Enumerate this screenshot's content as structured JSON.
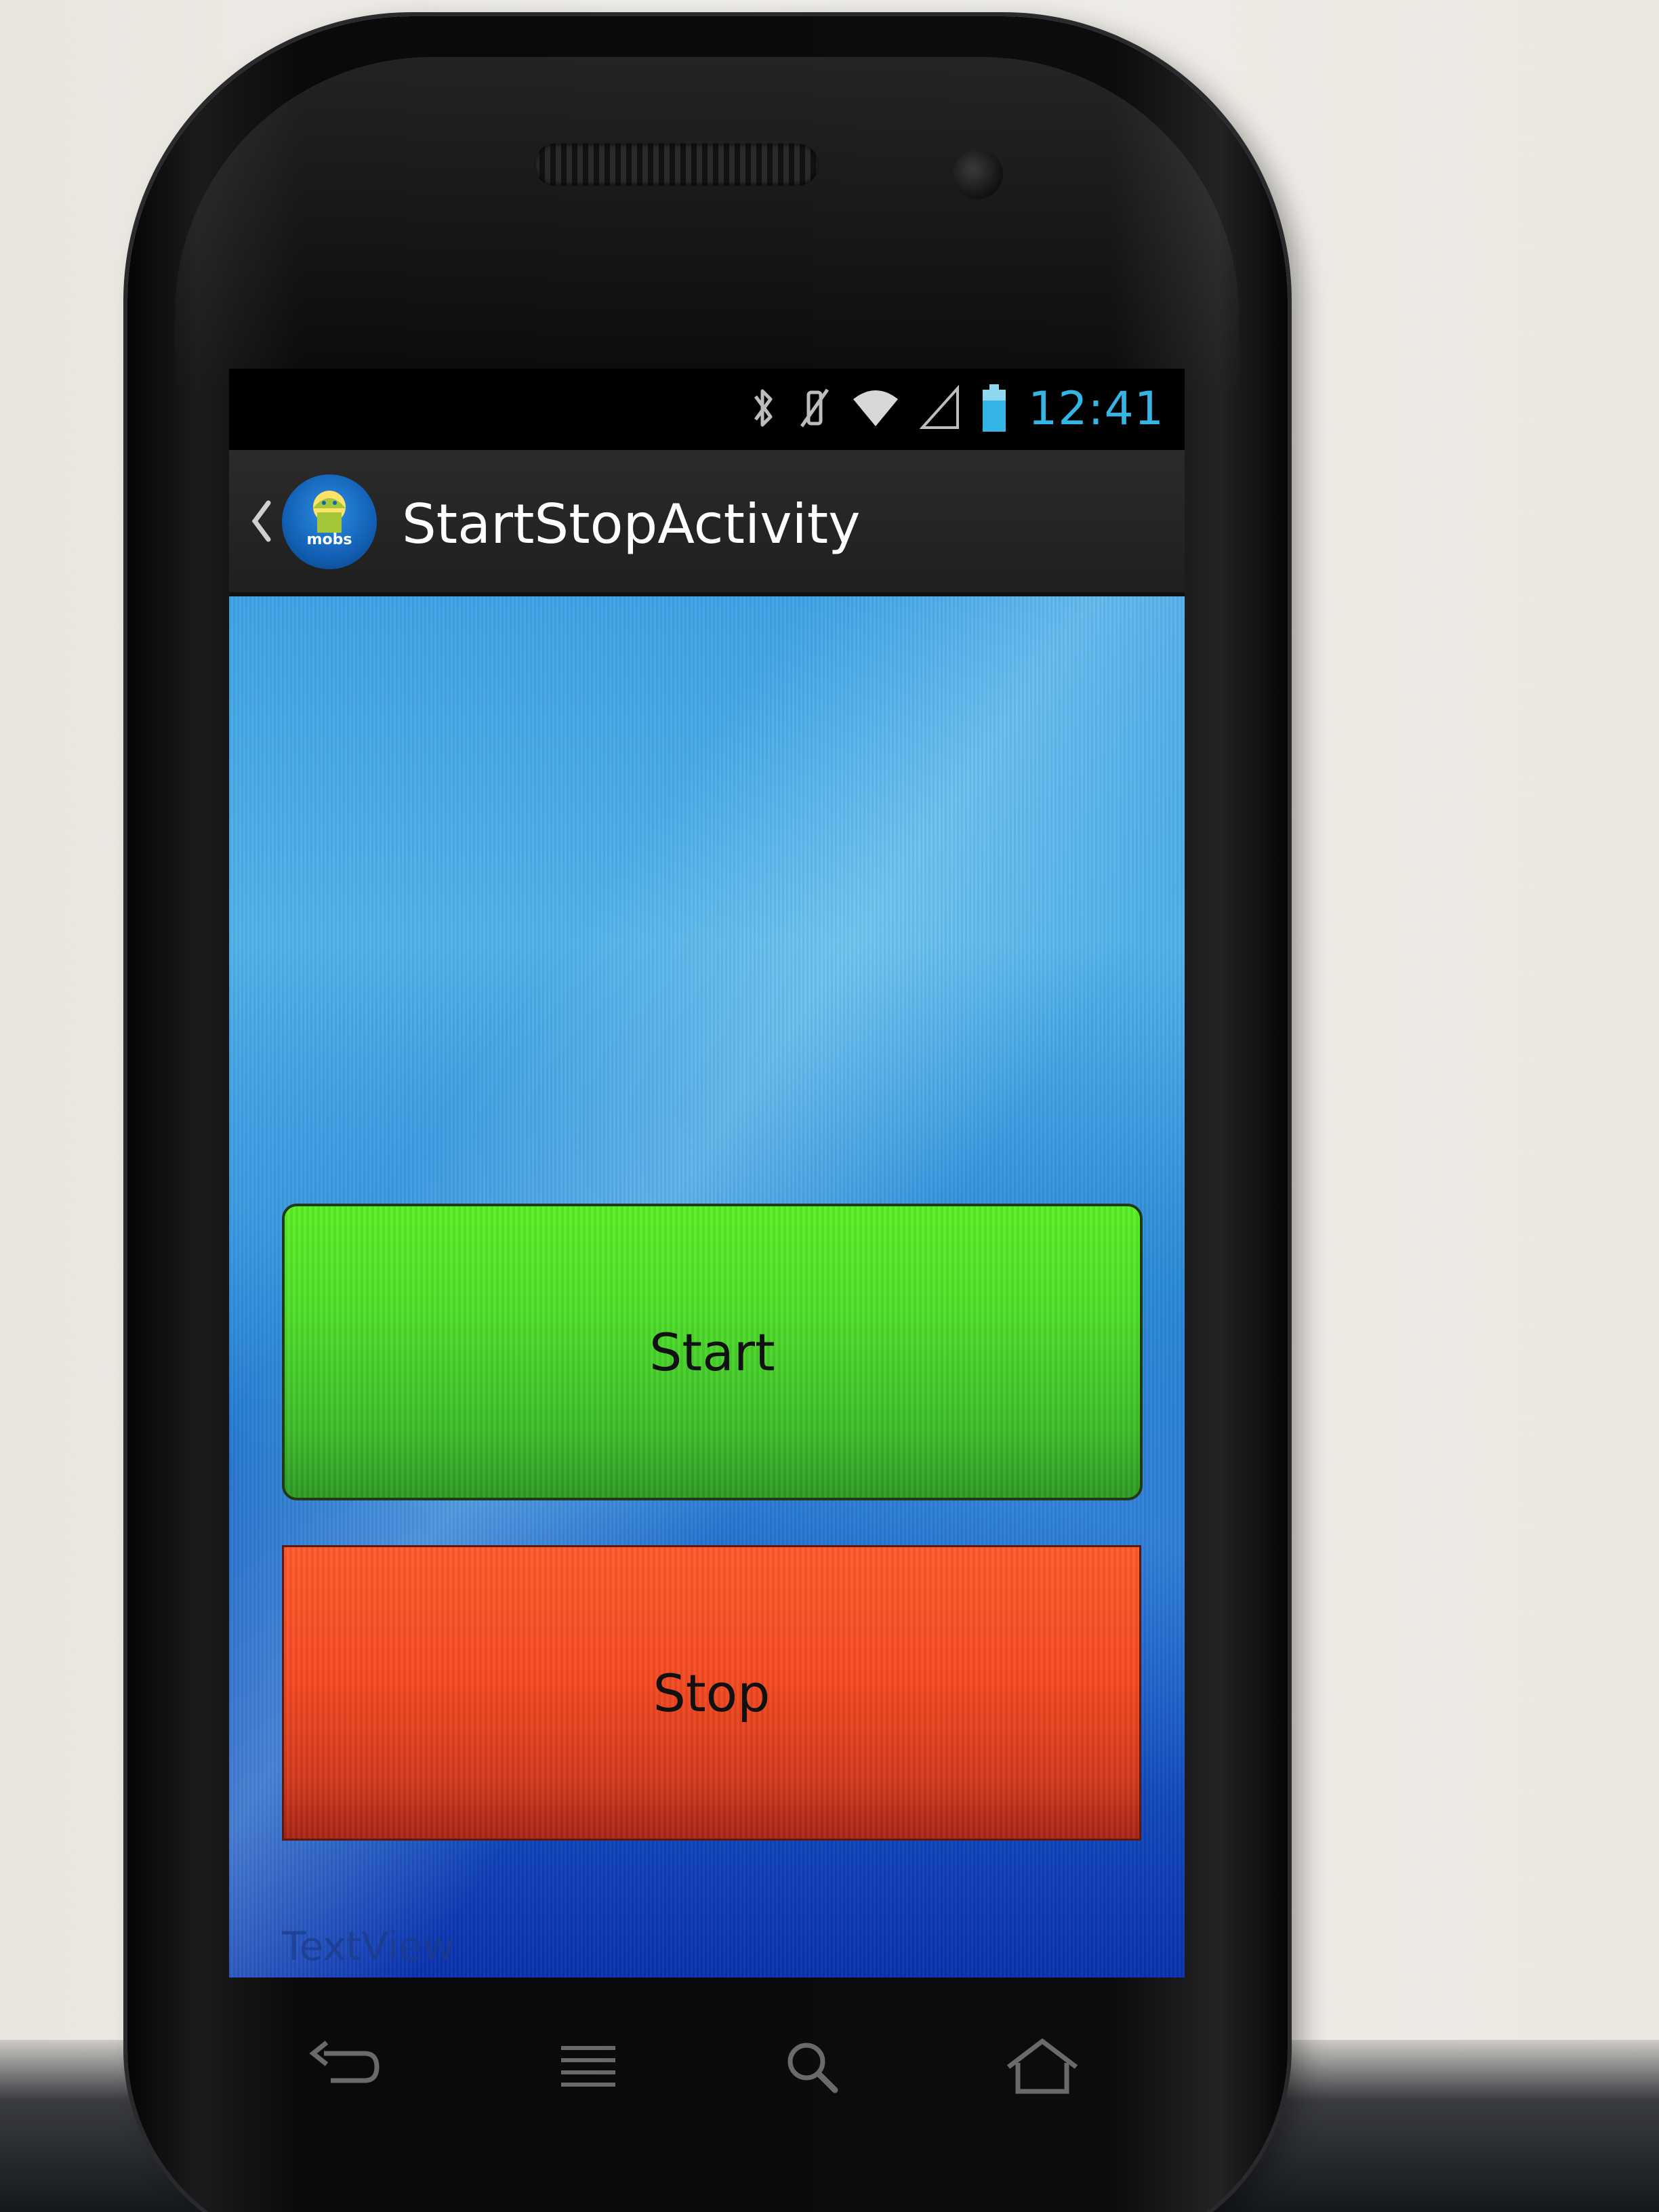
{
  "status_bar": {
    "icons": [
      "bluetooth-icon",
      "vibrate-icon",
      "wifi-icon",
      "signal-icon",
      "battery-icon"
    ],
    "time": "12:41",
    "accent_color": "#33b5e5"
  },
  "action_bar": {
    "title": "StartStopActivity",
    "app_icon_label": "mobs"
  },
  "buttons": {
    "start_label": "Start",
    "start_color": "#4fe02a",
    "stop_label": "Stop",
    "stop_color": "#f54a22"
  },
  "text_view": "TextView",
  "nav_keys": [
    "back-key-icon",
    "menu-key-icon",
    "search-key-icon",
    "home-key-icon"
  ]
}
